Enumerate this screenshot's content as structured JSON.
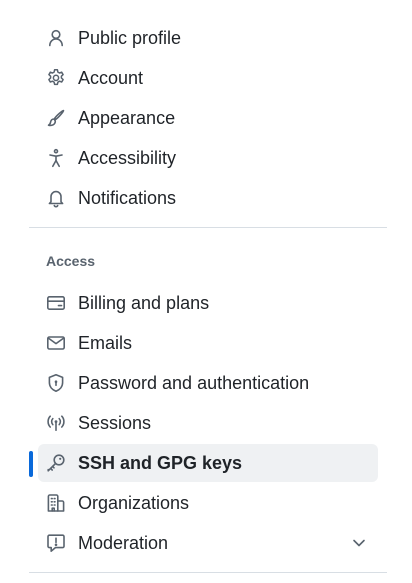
{
  "settings_nav": {
    "items_top": [
      {
        "label": "Public profile",
        "icon": "person-icon"
      },
      {
        "label": "Account",
        "icon": "gear-icon"
      },
      {
        "label": "Appearance",
        "icon": "paintbrush-icon"
      },
      {
        "label": "Accessibility",
        "icon": "accessibility-icon"
      },
      {
        "label": "Notifications",
        "icon": "bell-icon"
      }
    ],
    "access_heading": "Access",
    "items_access": [
      {
        "label": "Billing and plans",
        "icon": "credit-card-icon"
      },
      {
        "label": "Emails",
        "icon": "mail-icon"
      },
      {
        "label": "Password and authentication",
        "icon": "shield-lock-icon"
      },
      {
        "label": "Sessions",
        "icon": "broadcast-icon"
      },
      {
        "label": "SSH and GPG keys",
        "icon": "key-icon",
        "selected": true
      },
      {
        "label": "Organizations",
        "icon": "organization-icon"
      },
      {
        "label": "Moderation",
        "icon": "report-icon",
        "expandable": true
      }
    ]
  },
  "colors": {
    "selected_indicator": "#0969da",
    "selected_background": "#eff1f3",
    "text": "#1f2328",
    "muted_text": "#59636e",
    "divider": "#d8dee4"
  }
}
